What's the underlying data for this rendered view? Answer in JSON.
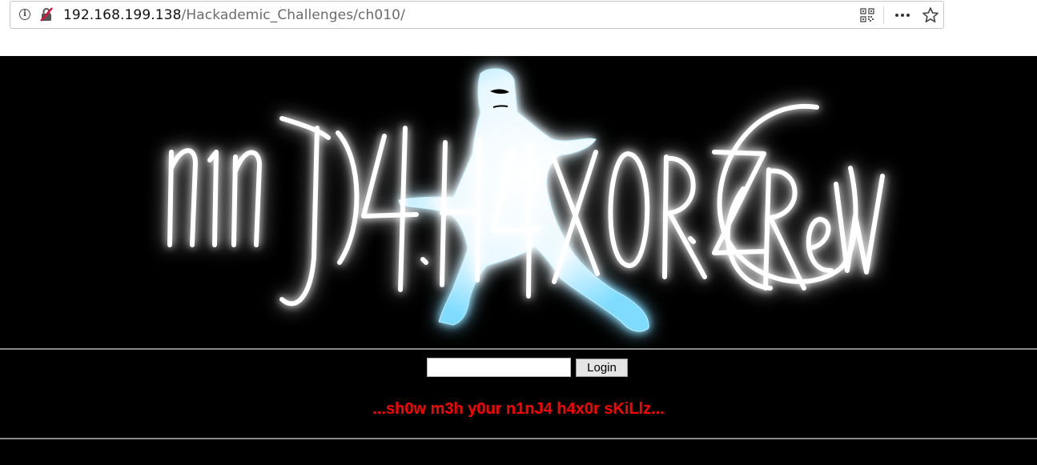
{
  "browser": {
    "url_host": "192.168.199.138",
    "url_path": "/Hackademic_Challenges/ch010/",
    "icons": [
      "info-icon",
      "insecure-connection-icon",
      "qr-code-icon",
      "more-options-icon",
      "bookmark-star-icon"
    ]
  },
  "page": {
    "banner_logo": "n1nJ4.H4X0RZ.CReW",
    "login": {
      "input_value": "",
      "button_label": "Login"
    },
    "tagline": "...sh0w m3h y0ur n1nJ4 h4x0r sKiLlz...",
    "colors": {
      "background": "#000000",
      "tagline": "#ff0000",
      "glow": "#29c8ff"
    }
  }
}
